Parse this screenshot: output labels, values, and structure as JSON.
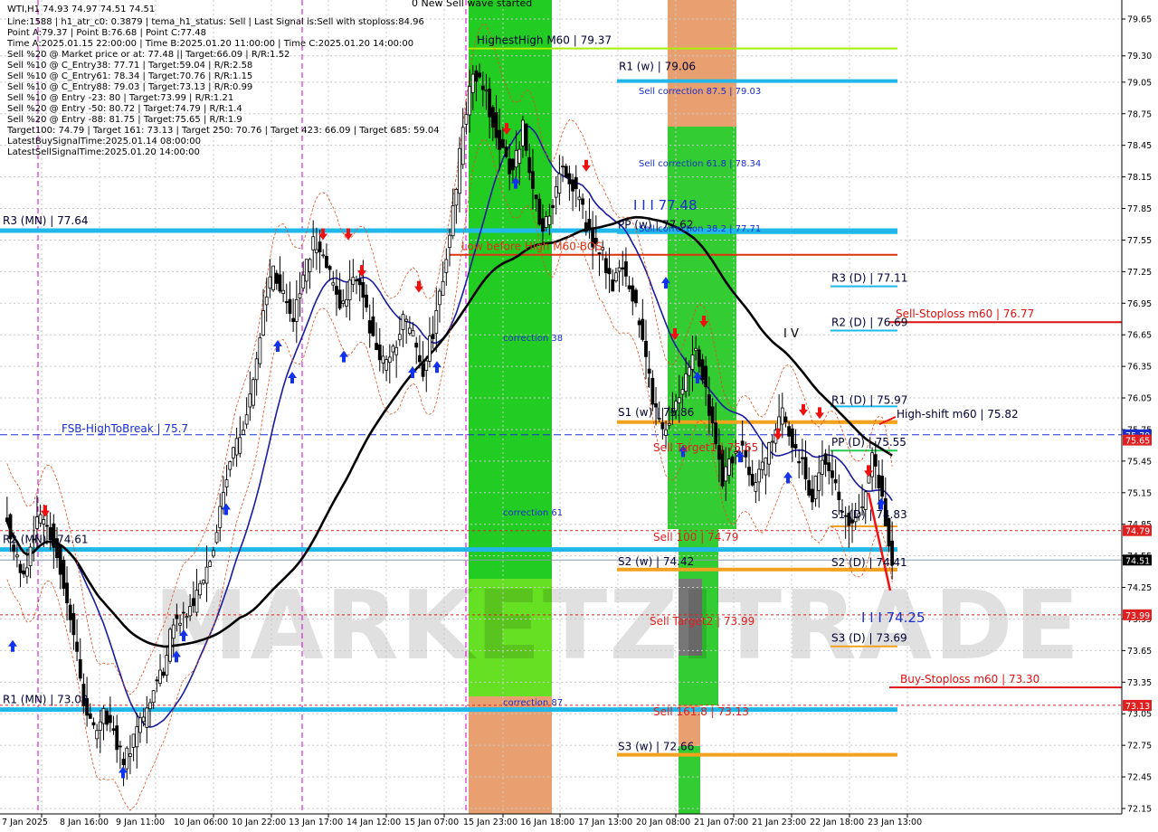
{
  "header": {
    "symbol_line": "WTI,H1  74.93 74.97 74.51 74.51",
    "top_label": "0 New Sell wave started",
    "info": [
      "Line:1588 | h1_atr_c0: 0.3879 | tema_h1_status: Sell | Last Signal is:Sell with stoploss:84.96",
      "Point A:79.37 | Point B:76.68 | Point C:77.48",
      "Time A:2025.01.15 22:00:00 | Time B:2025.01.20 11:00:00 | Time C:2025.01.20 14:00:00",
      "Sell %20 @ Market price or at: 77.48 || Target:66.09 | R/R:1.52",
      "Sell %10 @ C_Entry38: 77.71 | Target:59.04 | R/R:2.58",
      "Sell %10 @ C_Entry61: 78.34 | Target:70.76 | R/R:1.15",
      "Sell %10 @ C_Entry88: 79.03 | Target:73.13 | R/R:0.99",
      "Sell %10 @ Entry -23: 80 | Target:73.99 | R/R:1.21",
      "Sell %20 @ Entry -50: 80.72 | Target:74.79 | R/R:1.4",
      "Sell %20 @ Entry -88: 81.75 | Target:75.65 | R/R:1.9",
      "Target100: 74.79 | Target 161: 73.13 | Target 250: 70.76 | Target 423: 66.09 | Target 685: 59.04",
      "LatestBuySignalTime:2025.01.14 08:00:00",
      "LatestSellSignalTime:2025.01.20 14:00:00"
    ]
  },
  "watermark": "MARKETZITRADE",
  "axis": {
    "price_ticks": [
      "79.65",
      "79.30",
      "79.05",
      "78.75",
      "78.45",
      "78.15",
      "77.85",
      "77.55",
      "77.25",
      "76.95",
      "76.65",
      "76.35",
      "76.05",
      "75.75",
      "75.45",
      "75.15",
      "74.85",
      "74.55",
      "74.25",
      "73.95",
      "73.65",
      "73.35",
      "73.05",
      "72.75",
      "72.45",
      "72.15"
    ],
    "time_ticks": [
      "7 Jan 2025",
      "8 Jan 16:00",
      "9 Jan 11:00",
      "10 Jan 06:00",
      "10 Jan 22:00",
      "13 Jan 17:00",
      "14 Jan 12:00",
      "15 Jan 07:00",
      "15 Jan 23:00",
      "16 Jan 18:00",
      "17 Jan 13:00",
      "20 Jan 08:00",
      "21 Jan 07:00",
      "21 Jan 23:00",
      "22 Jan 18:00",
      "23 Jan 13:00"
    ]
  },
  "price_tags": [
    {
      "text": "75.70",
      "color": "#1a2ecc"
    },
    {
      "text": "75.65",
      "color": "#e02020"
    },
    {
      "text": "74.79",
      "color": "#e02020"
    },
    {
      "text": "74.51",
      "color": "#000000"
    },
    {
      "text": "73.99",
      "color": "#e02020"
    },
    {
      "text": "73.13",
      "color": "#e02020"
    }
  ],
  "levels": [
    {
      "label": "HighestHigh   M60 | 79.37",
      "color": "#aaee00"
    },
    {
      "label": "R1 (w) | 79.06",
      "color": "#1fb8e8"
    },
    {
      "label": "R3 (MN) | 77.64",
      "color": "#1fb8e8"
    },
    {
      "label": "PP (w) | 77.62",
      "color": "#1fb8e8"
    },
    {
      "label": "Low before High   M60-BOS",
      "color": "#dd3311"
    },
    {
      "label": "R3 (D) | 77.11",
      "color": "#1fb8e8"
    },
    {
      "label": "Sell-Stoploss m60 | 76.77",
      "color": "#dd1111"
    },
    {
      "label": "R2 (D) | 76.69",
      "color": "#1fb8e8"
    },
    {
      "label": "R1 (D) | 75.97",
      "color": "#1fb8e8"
    },
    {
      "label": "High-shift m60 | 75.82",
      "color": "#f2a21e"
    },
    {
      "label": "S1 (w) | 75.86",
      "color": "#f2a21e"
    },
    {
      "label": "FSB-HighToBreak | 75.7",
      "color": "#1a2ecc"
    },
    {
      "label": "PP (D) | 75.55",
      "color": "#22cc55"
    },
    {
      "label": "S1 (D) | 74.83",
      "color": "#f2a21e"
    },
    {
      "label": "R2 (MN) | 74.61",
      "color": "#1fb8e8"
    },
    {
      "label": "S2 (w) | 74.42",
      "color": "#f2a21e"
    },
    {
      "label": "S2 (D) | 74.41",
      "color": "#f2a21e"
    },
    {
      "label": "S3 (D) | 73.69",
      "color": "#f2a21e"
    },
    {
      "label": "Buy-Stoploss m60 | 73.30",
      "color": "#dd1111"
    },
    {
      "label": "R1 (MN) | 73.09",
      "color": "#1fb8e8"
    },
    {
      "label": "S3 (w) | 72.66",
      "color": "#f2a21e"
    }
  ],
  "annotations": [
    {
      "text": "Sell correction 87.5 | 79.03",
      "color": "#1a2ecc"
    },
    {
      "text": "Sell correction 61.8 | 78.34",
      "color": "#1a2ecc"
    },
    {
      "text": "Sell correction 38.2 | 77.71",
      "color": "#1a2ecc"
    },
    {
      "text": "I I I  77.48",
      "color": "#1a2ecc"
    },
    {
      "text": "correction 38",
      "color": "#1a2ecc"
    },
    {
      "text": "correction 61",
      "color": "#1a2ecc"
    },
    {
      "text": "correction 87",
      "color": "#1a2ecc"
    },
    {
      "text": "Sell Target1 | 75.65",
      "color": "#e02020"
    },
    {
      "text": "Sell 100 | 74.79",
      "color": "#e02020"
    },
    {
      "text": "Sell Target2 | 73.99",
      "color": "#e02020"
    },
    {
      "text": "Sell 161.8 | 73.13",
      "color": "#e02020"
    },
    {
      "text": "I I I  74.25",
      "color": "#1a2ecc"
    },
    {
      "text": "I V",
      "color": "#000000"
    },
    {
      "text": "I",
      "color": "#000000"
    }
  ],
  "chart_data": {
    "type": "candlestick",
    "title": "WTI,H1",
    "ylim": [
      72.15,
      79.65
    ],
    "x_labels": [
      "7 Jan 2025",
      "8 Jan 16:00",
      "9 Jan 11:00",
      "10 Jan 06:00",
      "10 Jan 22:00",
      "13 Jan 17:00",
      "14 Jan 12:00",
      "15 Jan 07:00",
      "15 Jan 23:00",
      "16 Jan 18:00",
      "17 Jan 13:00",
      "20 Jan 08:00",
      "21 Jan 07:00",
      "21 Jan 23:00",
      "22 Jan 18:00",
      "23 Jan 13:00"
    ],
    "close_path": [
      75.0,
      74.6,
      74.3,
      74.8,
      74.9,
      74.7,
      74.3,
      73.8,
      73.2,
      72.9,
      73.1,
      72.9,
      72.6,
      72.8,
      73.0,
      73.3,
      73.5,
      73.9,
      74.0,
      74.1,
      74.3,
      74.6,
      75.2,
      75.5,
      75.8,
      76.2,
      76.9,
      77.3,
      77.0,
      76.8,
      77.2,
      77.5,
      77.4,
      77.1,
      76.9,
      77.2,
      77.0,
      76.6,
      76.4,
      76.5,
      76.8,
      76.6,
      76.3,
      76.7,
      77.2,
      77.8,
      78.6,
      79.1,
      79.0,
      78.7,
      78.4,
      78.2,
      78.6,
      78.0,
      77.6,
      77.9,
      78.3,
      78.1,
      77.8,
      77.5,
      77.4,
      77.1,
      77.3,
      77.0,
      76.6,
      76.0,
      75.7,
      75.9,
      76.1,
      76.5,
      76.3,
      75.8,
      75.3,
      75.5,
      75.6,
      75.2,
      75.4,
      75.7,
      75.9,
      75.6,
      75.4,
      75.1,
      75.5,
      75.3,
      74.9,
      74.8,
      75.0,
      75.5,
      75.1,
      74.5
    ],
    "open": 74.93,
    "high": 74.97,
    "low": 74.51,
    "close": 74.51
  }
}
